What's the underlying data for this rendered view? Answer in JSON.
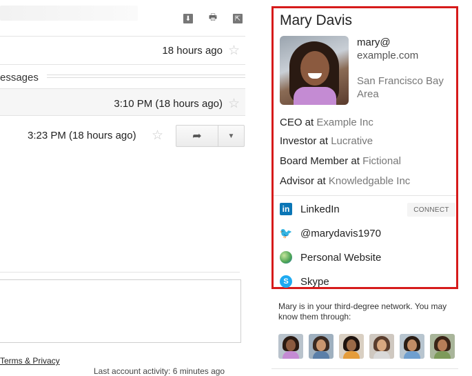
{
  "email": {
    "rows": [
      {
        "time": "18 hours ago"
      },
      {
        "time": "3:10 PM (18 hours ago)"
      },
      {
        "time": "3:23 PM (18 hours ago)"
      }
    ],
    "collapsed_label": "essages",
    "footer_link": "Terms & Privacy",
    "activity": "Last account activity: 6 minutes ago"
  },
  "contact": {
    "name": "Mary Davis",
    "email_user": "mary@",
    "email_domain": "example.com",
    "location": "San Francisco Bay Area",
    "roles": [
      {
        "title": "CEO at",
        "org": "Example Inc"
      },
      {
        "title": "Investor at",
        "org": "Lucrative"
      },
      {
        "title": "Board Member at",
        "org": "Fictional"
      },
      {
        "title": "Advisor at",
        "org": "Knowledgable Inc"
      }
    ],
    "social": [
      {
        "label": "LinkedIn",
        "icon": "linkedin-icon"
      },
      {
        "label": "@marydavis1970",
        "icon": "twitter-icon"
      },
      {
        "label": "Personal Website",
        "icon": "globe-icon"
      },
      {
        "label": "Skype",
        "icon": "skype-icon"
      }
    ],
    "connect_label": "CONNECT",
    "network_text": "Mary is in your third-degree network. You may know them through:",
    "accent_color": "#d61a1a"
  }
}
